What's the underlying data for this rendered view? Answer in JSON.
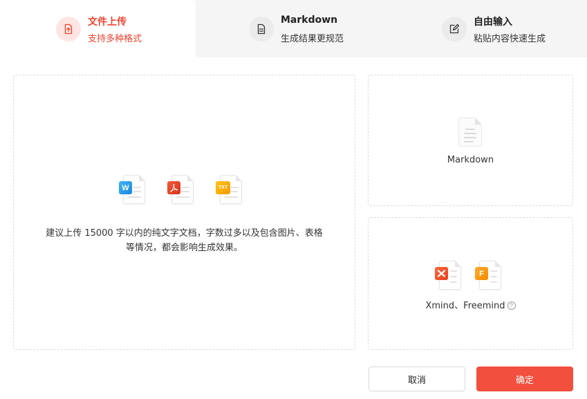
{
  "tabs": [
    {
      "title": "文件上传",
      "subtitle": "支持多种格式",
      "icon": "upload-file-icon",
      "active": true
    },
    {
      "title": "Markdown",
      "subtitle": "生成结果更规范",
      "icon": "document-icon",
      "active": false
    },
    {
      "title": "自由输入",
      "subtitle": "粘贴内容快速生成",
      "icon": "edit-icon",
      "active": false
    }
  ],
  "upload": {
    "file_types": [
      {
        "badge": "W",
        "icon": "word-file-icon"
      },
      {
        "badge": "pdf",
        "icon": "pdf-file-icon"
      },
      {
        "badge": "TXT",
        "icon": "txt-file-icon"
      }
    ],
    "hint_line1": "建议上传 15000 字以内的纯文字文档，字数过多以及包含图片、表格",
    "hint_line2": "等情况，都会影响生成效果。"
  },
  "markdown_panel": {
    "label": "Markdown",
    "icon": "markdown-file-icon"
  },
  "mindmap_panel": {
    "label": "Xmind、Freemind",
    "help": "?",
    "file_types": [
      {
        "badge": "X",
        "icon": "xmind-file-icon"
      },
      {
        "badge": "F",
        "icon": "freemind-file-icon"
      }
    ]
  },
  "buttons": {
    "cancel": "取消",
    "confirm": "确定"
  },
  "colors": {
    "accent": "#f24f3f",
    "active_text": "#f0432f",
    "tab_bg": "#f5f5f5",
    "active_icon_bg": "#fde5e3"
  }
}
